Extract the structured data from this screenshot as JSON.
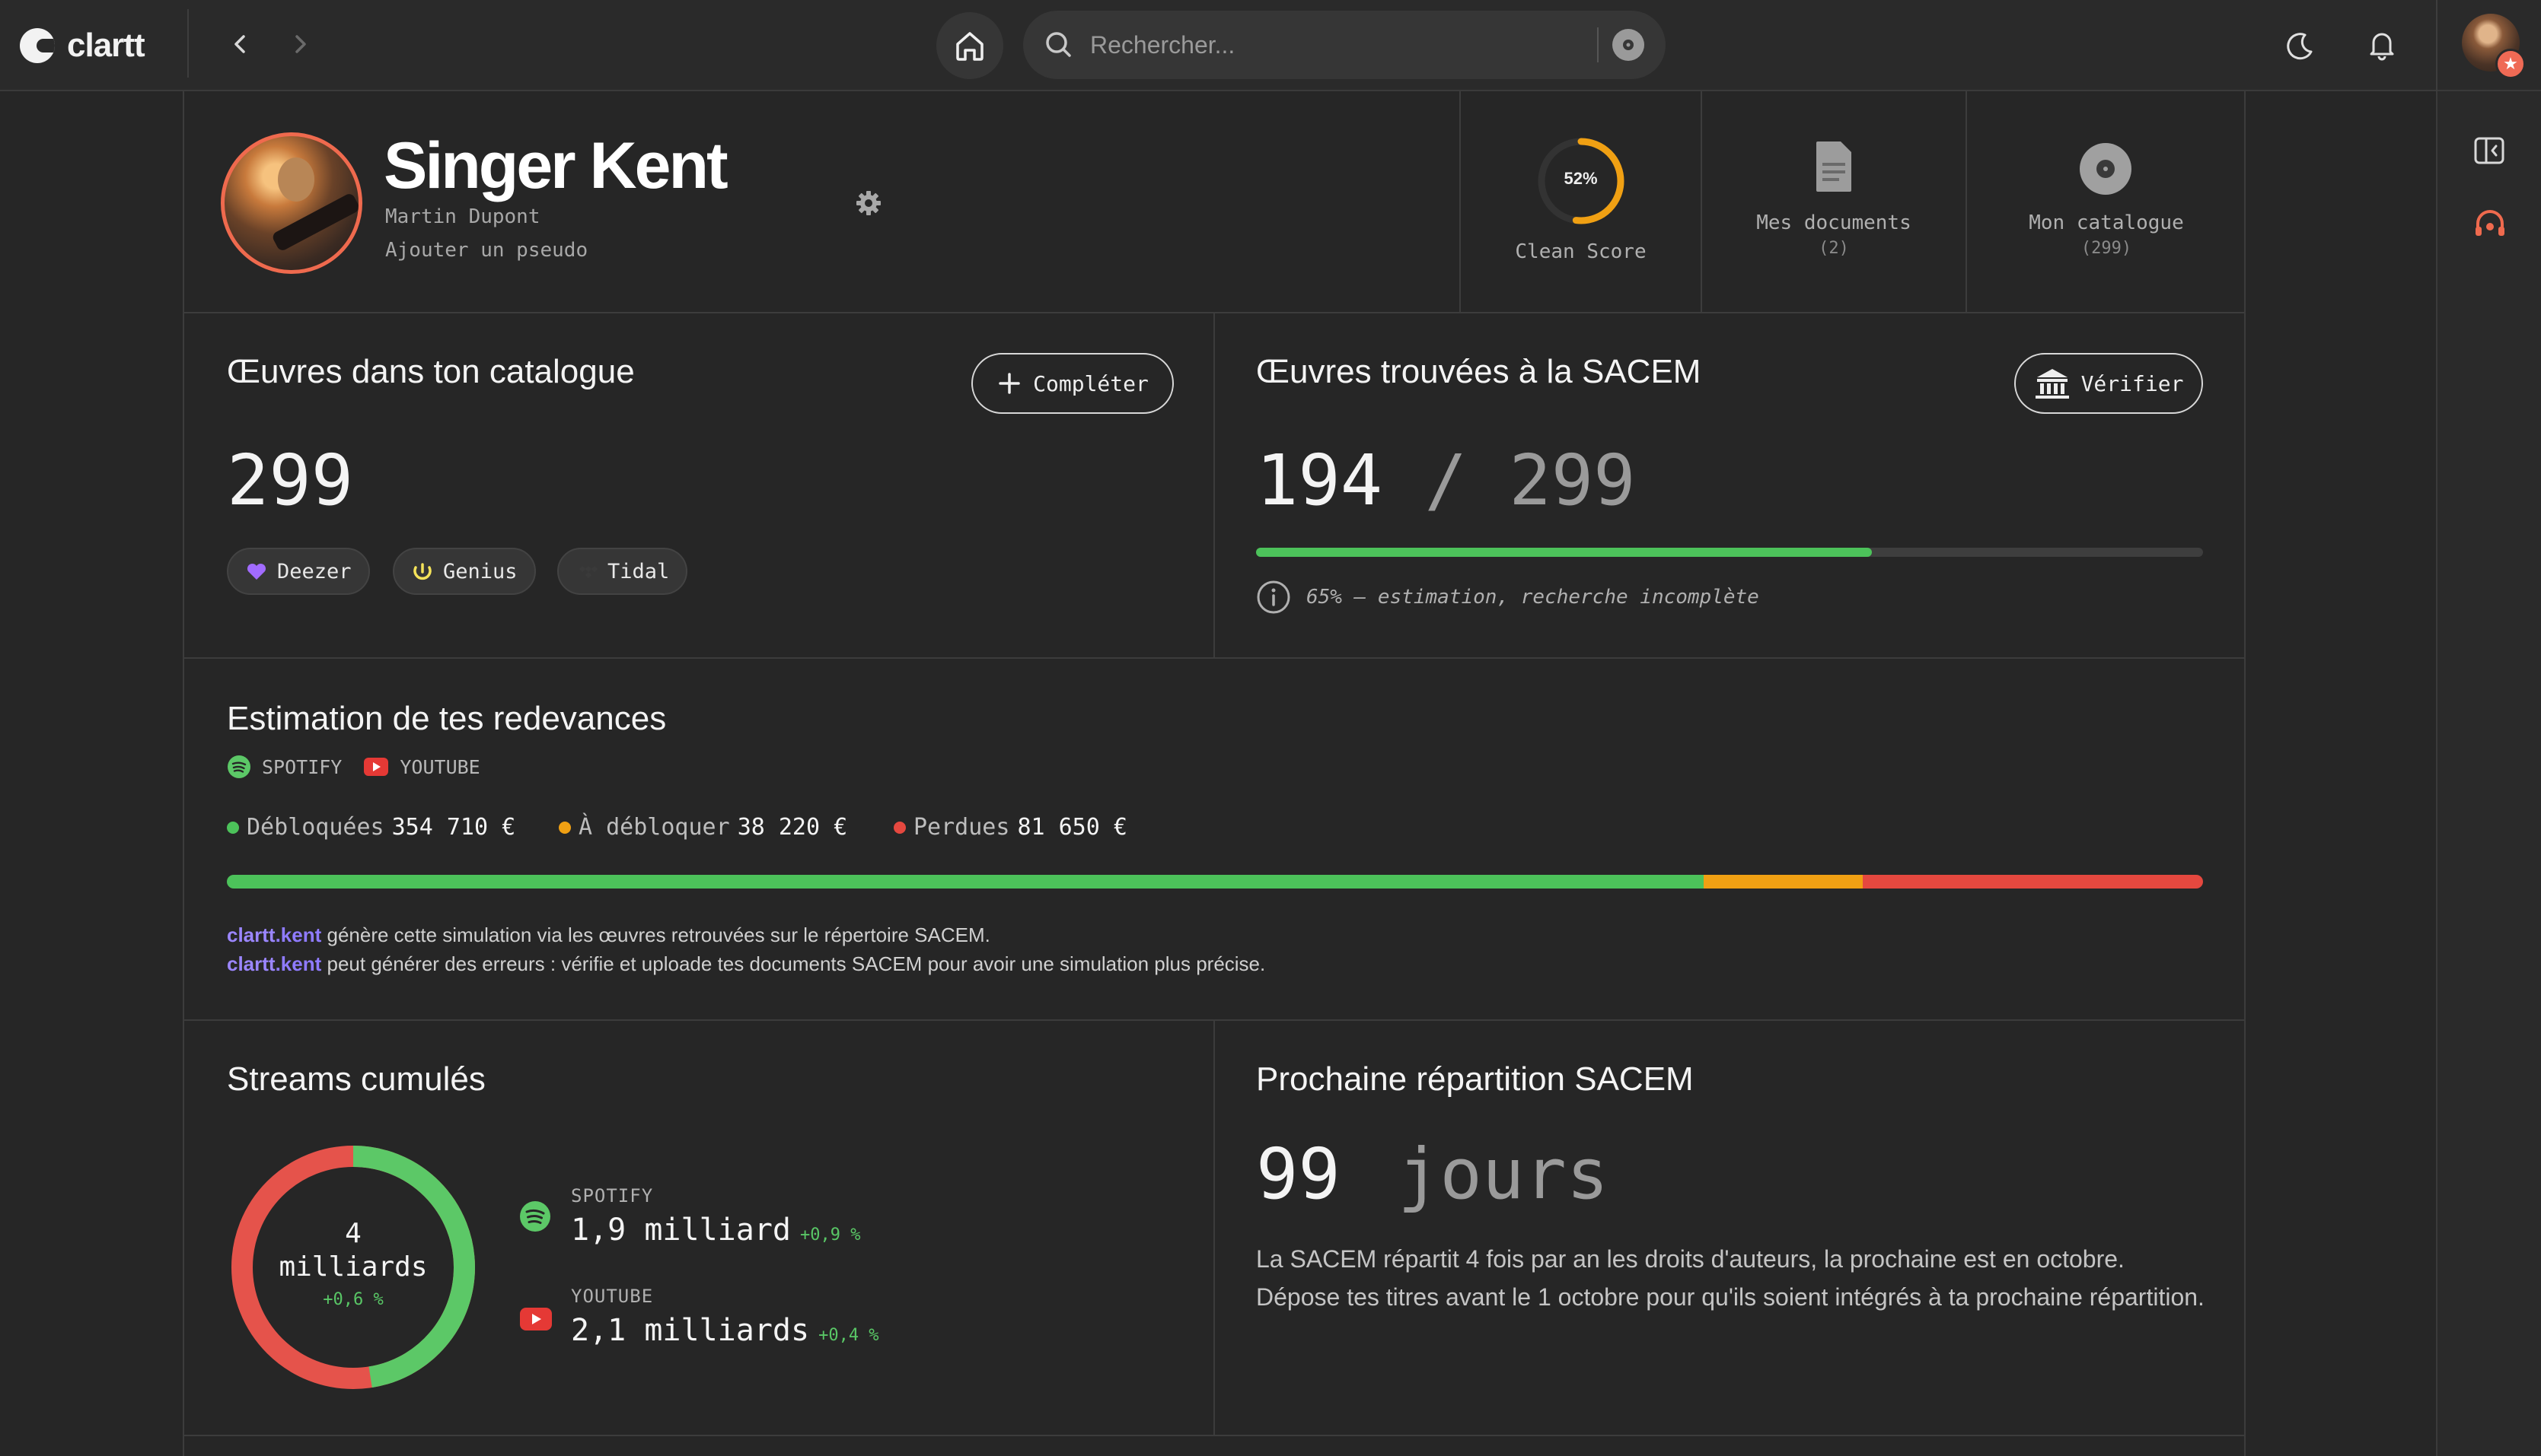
{
  "app": {
    "name": "clartt"
  },
  "search": {
    "placeholder": "Rechercher..."
  },
  "profile": {
    "artist_name": "Singer Kent",
    "real_name": "Martin Dupont",
    "pseudo_link": "Ajouter un pseudo"
  },
  "stats": {
    "clean_score": {
      "value": "52%",
      "percent": 52,
      "label": "Clean Score"
    },
    "documents": {
      "label": "Mes documents",
      "count": "(2)"
    },
    "catalogue": {
      "label": "Mon catalogue",
      "count": "(299)"
    }
  },
  "catalogue_card": {
    "title": "Œuvres dans ton catalogue",
    "button": "Compléter",
    "count": "299",
    "sources": [
      "Deezer",
      "Genius",
      "Tidal"
    ]
  },
  "sacem_card": {
    "title": "Œuvres trouvées à la SACEM",
    "button": "Vérifier",
    "found": "194",
    "slash": "/",
    "total": "299",
    "progress": 0.65,
    "note": "65% — estimation, recherche incomplète"
  },
  "royalties": {
    "title": "Estimation de tes redevances",
    "platforms": [
      "SPOTIFY",
      "YOUTUBE"
    ],
    "legend": [
      {
        "label": "Débloquées",
        "value": "354 710 €",
        "color": "#4cc25a",
        "amount": 354710
      },
      {
        "label": "À débloquer",
        "value": "38 220 €",
        "color": "#f0a013",
        "amount": 38220
      },
      {
        "label": "Perdues",
        "value": "81 650 €",
        "color": "#e5483f",
        "amount": 81650
      }
    ],
    "note1_brand": "clartt",
    "note1_dot": ".kent",
    "note1_text": " génère cette simulation via les œuvres retrouvées sur le répertoire SACEM.",
    "note2_brand": "clartt",
    "note2_dot": ".kent",
    "note2_text": " peut générer des erreurs : vérifie et uploade tes documents SACEM pour avoir une simulation plus précise."
  },
  "streams": {
    "title": "Streams cumulés",
    "total_line1": "4",
    "total_line2": "milliards",
    "total_delta": "+0,6 %",
    "spotify": {
      "label": "SPOTIFY",
      "value": "1,9 milliard",
      "delta": "+0,9 %",
      "share": 0.475,
      "color": "#5cc867"
    },
    "youtube": {
      "label": "YOUTUBE",
      "value": "2,1 milliards",
      "delta": "+0,4 %",
      "share": 0.525,
      "color": "#e5534b"
    }
  },
  "repartition": {
    "title": "Prochaine répartition SACEM",
    "days": "99",
    "unit": "jours",
    "text": "La SACEM répartit 4 fois par an les droits d'auteurs, la prochaine est en octobre. Dépose tes titres avant le 1 octobre pour qu'ils soient intégrés à ta prochaine répartition."
  }
}
